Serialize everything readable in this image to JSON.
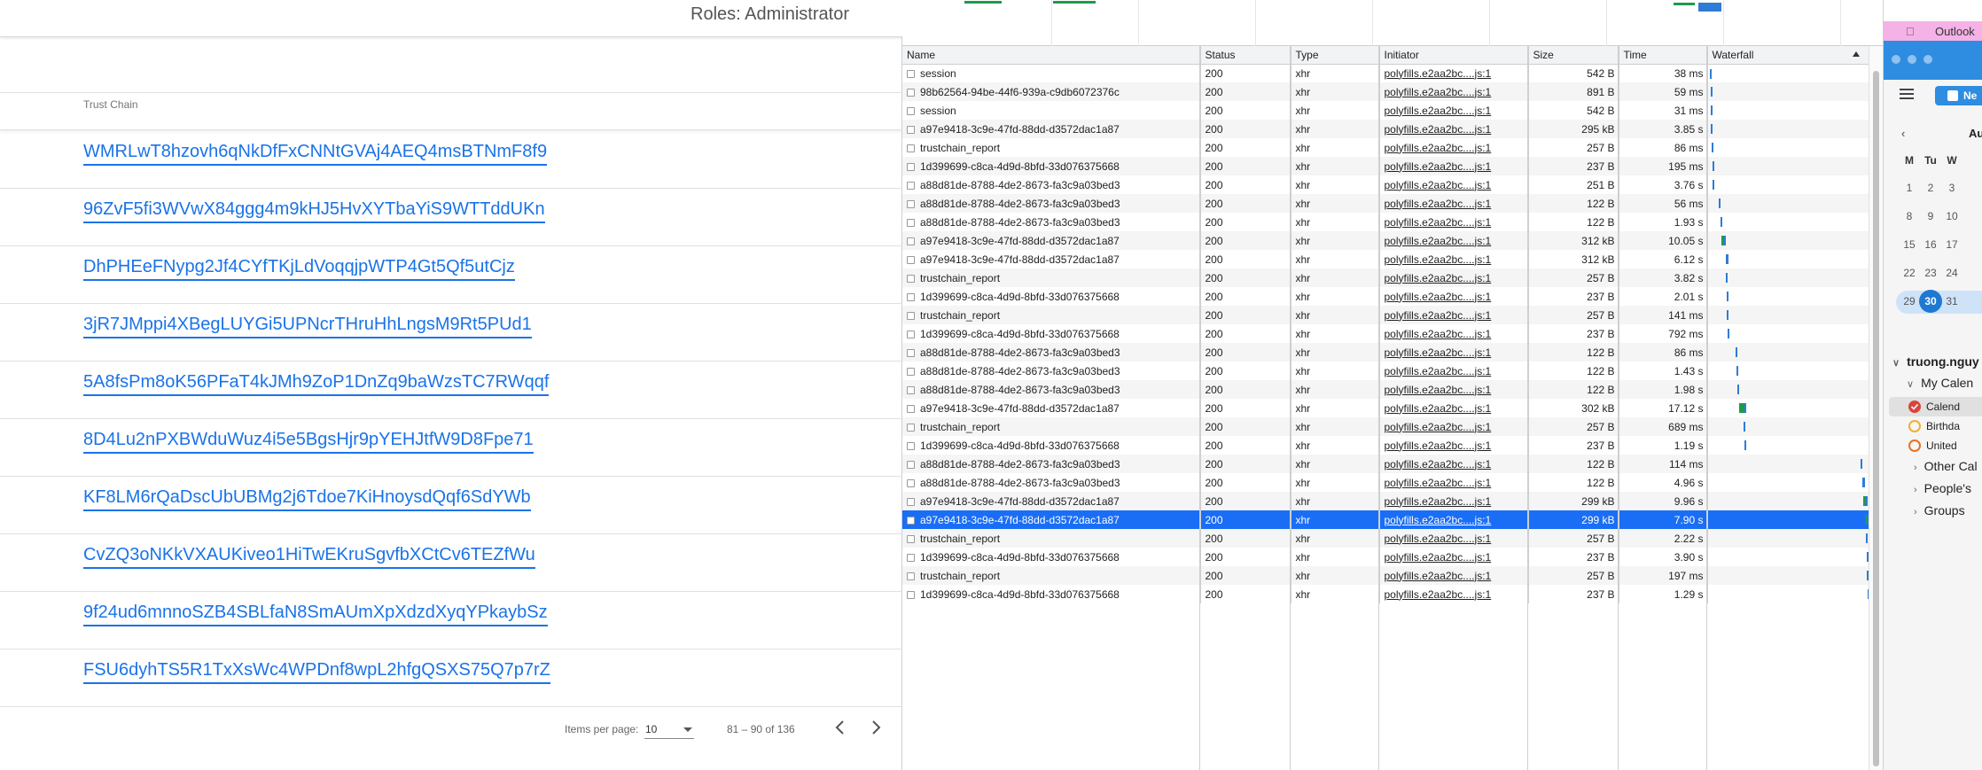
{
  "app": {
    "roles_label": "Roles: Administrator",
    "column_header": "Trust Chain",
    "trust_chains": [
      "WMRLwT8hzovh6qNkDfFxCNNtGVAj4AEQ4msBTNmF8f9",
      "96ZvF5fi3WVwX84ggg4m9kHJ5HvXYTbaYiS9WTTddUKn",
      "DhPHEeFNypg2Jf4CYfTKjLdVoqqjpWTP4Gt5Qf5utCjz",
      "3jR7JMppi4XBegLUYGi5UPNcrTHruHhLngsM9Rt5PUd1",
      "5A8fsPm8oK56PFaT4kJMh9ZoP1DnZq9baWzsTC7RWqqf",
      "8D4Lu2nPXBWduWuz4i5e5BgsHjr9pYEHJtfW9D8Fpe71",
      "KF8LM6rQaDscUbUBMg2j6Tdoe7KiHnoysdQqf6SdYWb",
      "CvZQ3oNKkVXAUKiveo1HiTwEKruSgvfbXCtCv6TEZfWu",
      "9f24ud6mnnoSZB4SBLfaN8SmAUmXpXdzdXyqYPkaybSz",
      "FSU6dyhTS5R1TxXsWc4WPDnf8wpL2hfgQSXS75Q7p7rZ"
    ],
    "pager": {
      "items_per_page_label": "Items per page:",
      "items_per_page_value": "10",
      "range": "81 – 90 of 136"
    }
  },
  "network": {
    "columns": [
      "Name",
      "Status",
      "Type",
      "Initiator",
      "Size",
      "Time",
      "Waterfall"
    ],
    "waterfall_color_waiting": "#1f9a4a",
    "waterfall_color_download": "#2e7cd6",
    "rows": [
      {
        "name": "session",
        "status": "200",
        "type": "xhr",
        "initiator": "polyfills.e2aa2bc....js:1",
        "size": "542 B",
        "time": "38 ms",
        "wf_start": 0.012,
        "wf_len": 0.005
      },
      {
        "name": "98b62564-94be-44f6-939a-c9db6072376c",
        "status": "200",
        "type": "xhr",
        "initiator": "polyfills.e2aa2bc....js:1",
        "size": "891 B",
        "time": "59 ms",
        "wf_start": 0.014,
        "wf_len": 0.005
      },
      {
        "name": "session",
        "status": "200",
        "type": "xhr",
        "initiator": "polyfills.e2aa2bc....js:1",
        "size": "542 B",
        "time": "31 ms",
        "wf_start": 0.016,
        "wf_len": 0.005
      },
      {
        "name": "a97e9418-3c9e-47fd-88dd-d3572dac1a87",
        "status": "200",
        "type": "xhr",
        "initiator": "polyfills.e2aa2bc....js:1",
        "size": "295 kB",
        "time": "3.85 s",
        "wf_start": 0.018,
        "wf_len": 0.01
      },
      {
        "name": "trustchain_report",
        "status": "200",
        "type": "xhr",
        "initiator": "polyfills.e2aa2bc....js:1",
        "size": "257 B",
        "time": "86 ms",
        "wf_start": 0.024,
        "wf_len": 0.005
      },
      {
        "name": "1d399699-c8ca-4d9d-8bfd-33d076375668",
        "status": "200",
        "type": "xhr",
        "initiator": "polyfills.e2aa2bc....js:1",
        "size": "237 B",
        "time": "195 ms",
        "wf_start": 0.026,
        "wf_len": 0.005
      },
      {
        "name": "a88d81de-8788-4de2-8673-fa3c9a03bed3",
        "status": "200",
        "type": "xhr",
        "initiator": "polyfills.e2aa2bc....js:1",
        "size": "251 B",
        "time": "3.76 s",
        "wf_start": 0.028,
        "wf_len": 0.01
      },
      {
        "name": "a88d81de-8788-4de2-8673-fa3c9a03bed3",
        "status": "200",
        "type": "xhr",
        "initiator": "polyfills.e2aa2bc....js:1",
        "size": "122 B",
        "time": "56 ms",
        "wf_start": 0.068,
        "wf_len": 0.005
      },
      {
        "name": "a88d81de-8788-4de2-8673-fa3c9a03bed3",
        "status": "200",
        "type": "xhr",
        "initiator": "polyfills.e2aa2bc....js:1",
        "size": "122 B",
        "time": "1.93 s",
        "wf_start": 0.078,
        "wf_len": 0.008
      },
      {
        "name": "a97e9418-3c9e-47fd-88dd-d3572dac1a87",
        "status": "200",
        "type": "xhr",
        "initiator": "polyfills.e2aa2bc....js:1",
        "size": "312 kB",
        "time": "10.05 s",
        "wf_start": 0.085,
        "wf_len": 0.025
      },
      {
        "name": "a97e9418-3c9e-47fd-88dd-d3572dac1a87",
        "status": "200",
        "type": "xhr",
        "initiator": "polyfills.e2aa2bc....js:1",
        "size": "312 kB",
        "time": "6.12 s",
        "wf_start": 0.11,
        "wf_len": 0.015
      },
      {
        "name": "trustchain_report",
        "status": "200",
        "type": "xhr",
        "initiator": "polyfills.e2aa2bc....js:1",
        "size": "257 B",
        "time": "3.82 s",
        "wf_start": 0.112,
        "wf_len": 0.01
      },
      {
        "name": "1d399699-c8ca-4d9d-8bfd-33d076375668",
        "status": "200",
        "type": "xhr",
        "initiator": "polyfills.e2aa2bc....js:1",
        "size": "237 B",
        "time": "2.01 s",
        "wf_start": 0.114,
        "wf_len": 0.008
      },
      {
        "name": "trustchain_report",
        "status": "200",
        "type": "xhr",
        "initiator": "polyfills.e2aa2bc....js:1",
        "size": "257 B",
        "time": "141 ms",
        "wf_start": 0.118,
        "wf_len": 0.005
      },
      {
        "name": "1d399699-c8ca-4d9d-8bfd-33d076375668",
        "status": "200",
        "type": "xhr",
        "initiator": "polyfills.e2aa2bc....js:1",
        "size": "237 B",
        "time": "792 ms",
        "wf_start": 0.122,
        "wf_len": 0.006
      },
      {
        "name": "a88d81de-8788-4de2-8673-fa3c9a03bed3",
        "status": "200",
        "type": "xhr",
        "initiator": "polyfills.e2aa2bc....js:1",
        "size": "122 B",
        "time": "86 ms",
        "wf_start": 0.168,
        "wf_len": 0.005
      },
      {
        "name": "a88d81de-8788-4de2-8673-fa3c9a03bed3",
        "status": "200",
        "type": "xhr",
        "initiator": "polyfills.e2aa2bc....js:1",
        "size": "122 B",
        "time": "1.43 s",
        "wf_start": 0.178,
        "wf_len": 0.008
      },
      {
        "name": "a88d81de-8788-4de2-8673-fa3c9a03bed3",
        "status": "200",
        "type": "xhr",
        "initiator": "polyfills.e2aa2bc....js:1",
        "size": "122 B",
        "time": "1.98 s",
        "wf_start": 0.184,
        "wf_len": 0.008
      },
      {
        "name": "a97e9418-3c9e-47fd-88dd-d3572dac1a87",
        "status": "200",
        "type": "xhr",
        "initiator": "polyfills.e2aa2bc....js:1",
        "size": "302 kB",
        "time": "17.12 s",
        "wf_start": 0.19,
        "wf_len": 0.045
      },
      {
        "name": "trustchain_report",
        "status": "200",
        "type": "xhr",
        "initiator": "polyfills.e2aa2bc....js:1",
        "size": "257 B",
        "time": "689 ms",
        "wf_start": 0.222,
        "wf_len": 0.005
      },
      {
        "name": "1d399699-c8ca-4d9d-8bfd-33d076375668",
        "status": "200",
        "type": "xhr",
        "initiator": "polyfills.e2aa2bc....js:1",
        "size": "237 B",
        "time": "1.19 s",
        "wf_start": 0.226,
        "wf_len": 0.007
      },
      {
        "name": "a88d81de-8788-4de2-8673-fa3c9a03bed3",
        "status": "200",
        "type": "xhr",
        "initiator": "polyfills.e2aa2bc....js:1",
        "size": "122 B",
        "time": "114 ms",
        "wf_start": 0.945,
        "wf_len": 0.005
      },
      {
        "name": "a88d81de-8788-4de2-8673-fa3c9a03bed3",
        "status": "200",
        "type": "xhr",
        "initiator": "polyfills.e2aa2bc....js:1",
        "size": "122 B",
        "time": "4.96 s",
        "wf_start": 0.955,
        "wf_len": 0.015
      },
      {
        "name": "a97e9418-3c9e-47fd-88dd-d3572dac1a87",
        "status": "200",
        "type": "xhr",
        "initiator": "polyfills.e2aa2bc....js:1",
        "size": "299 kB",
        "time": "9.96 s",
        "wf_start": 0.962,
        "wf_len": 0.025
      },
      {
        "name": "a97e9418-3c9e-47fd-88dd-d3572dac1a87",
        "status": "200",
        "type": "xhr",
        "initiator": "polyfills.e2aa2bc....js:1",
        "size": "299 kB",
        "time": "7.90 s",
        "wf_start": 0.975,
        "wf_len": 0.02,
        "selected": true
      },
      {
        "name": "trustchain_report",
        "status": "200",
        "type": "xhr",
        "initiator": "polyfills.e2aa2bc....js:1",
        "size": "257 B",
        "time": "2.22 s",
        "wf_start": 0.98,
        "wf_len": 0.01
      },
      {
        "name": "1d399699-c8ca-4d9d-8bfd-33d076375668",
        "status": "200",
        "type": "xhr",
        "initiator": "polyfills.e2aa2bc....js:1",
        "size": "237 B",
        "time": "3.90 s",
        "wf_start": 0.982,
        "wf_len": 0.01
      },
      {
        "name": "trustchain_report",
        "status": "200",
        "type": "xhr",
        "initiator": "polyfills.e2aa2bc....js:1",
        "size": "257 B",
        "time": "197 ms",
        "wf_start": 0.985,
        "wf_len": 0.005
      },
      {
        "name": "1d399699-c8ca-4d9d-8bfd-33d076375668",
        "status": "200",
        "type": "xhr",
        "initiator": "polyfills.e2aa2bc....js:1",
        "size": "237 B",
        "time": "1.29 s",
        "wf_start": 0.988,
        "wf_len": 0.008
      }
    ]
  },
  "outlook": {
    "app_name": "Outlook",
    "new_button": "Ne",
    "month_label": "Au",
    "weekdays": [
      "M",
      "Tu",
      "W"
    ],
    "weeks": [
      [
        "1",
        "2",
        "3"
      ],
      [
        "8",
        "9",
        "10"
      ],
      [
        "15",
        "16",
        "17"
      ],
      [
        "22",
        "23",
        "24"
      ],
      [
        "29",
        "30",
        "31"
      ]
    ],
    "today": "30",
    "account": "truong.nguy",
    "my_calendars": "My Calen",
    "calendars": [
      {
        "label": "Calend",
        "color": "#d9453b",
        "checked": true
      },
      {
        "label": "Birthda",
        "color": "#f0b030",
        "checked": false
      },
      {
        "label": "United",
        "color": "#e8711f",
        "checked": false
      }
    ],
    "other_calendars": "Other Cal",
    "peoples": "People's",
    "groups": "Groups"
  }
}
